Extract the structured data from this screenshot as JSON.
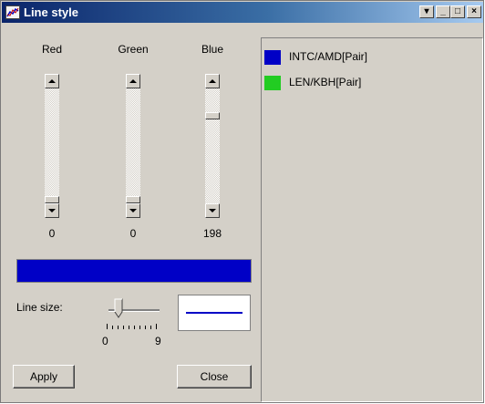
{
  "window": {
    "title": "Line style",
    "icon": "line-chart-icon",
    "buttons": {
      "restore_label": "▾",
      "minimize_label": "_",
      "maximize_label": "□",
      "close_label": "×"
    }
  },
  "sliders": [
    {
      "label": "Red",
      "value": "0",
      "level": 0
    },
    {
      "label": "Green",
      "value": "0",
      "level": 0
    },
    {
      "label": "Blue",
      "value": "198",
      "level": 0.776
    }
  ],
  "color_preview": {
    "color": "#0000c6"
  },
  "line_size": {
    "label": "Line size:",
    "min": "0",
    "max": "9",
    "value": 1
  },
  "buttons": {
    "apply": "Apply",
    "close": "Close"
  },
  "series": [
    {
      "name": "INTC/AMD[Pair]",
      "color": "#0000c6"
    },
    {
      "name": "LEN/KBH[Pair]",
      "color": "#22cc22"
    }
  ]
}
